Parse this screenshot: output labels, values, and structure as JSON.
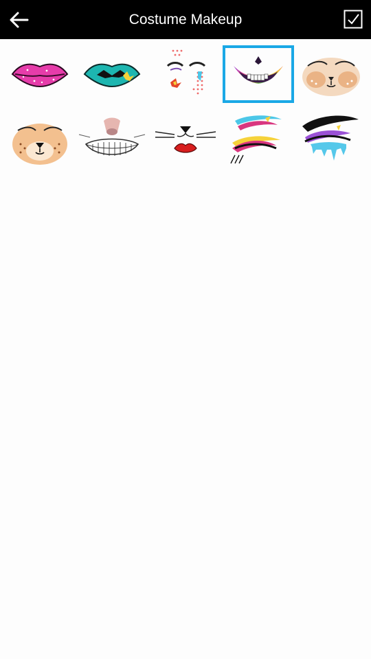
{
  "header": {
    "title": "Costume Makeup",
    "back_icon": "arrow-left-icon",
    "confirm_icon": "checkbox-check-icon"
  },
  "colors": {
    "topbar": "#000000",
    "selection": "#1AA8E6",
    "background": "#FDFDFD"
  },
  "looks": [
    {
      "name": "pink-glitter-lips-icon",
      "selected": false
    },
    {
      "name": "teal-pop-lips-icon",
      "selected": false
    },
    {
      "name": "comic-pop-art-face-icon",
      "selected": false
    },
    {
      "name": "rainbow-skull-mouth-icon",
      "selected": true
    },
    {
      "name": "bunny-face-icon",
      "selected": false
    },
    {
      "name": "cat-face-icon",
      "selected": false
    },
    {
      "name": "cheshire-grin-icon",
      "selected": false
    },
    {
      "name": "kitten-whiskers-lips-icon",
      "selected": false
    },
    {
      "name": "neon-winged-eyes-icon",
      "selected": false
    },
    {
      "name": "dripping-purple-eye-icon",
      "selected": false
    }
  ]
}
